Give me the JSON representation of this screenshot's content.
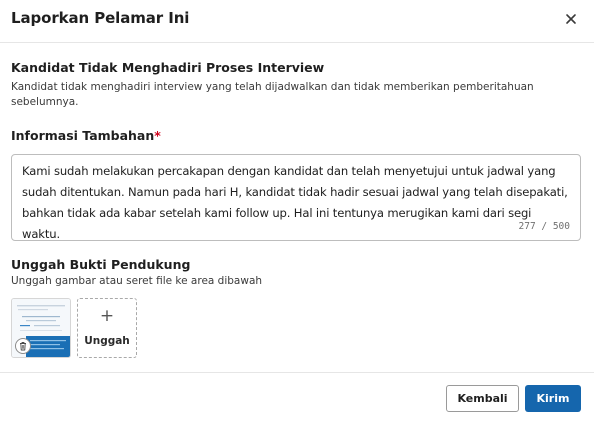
{
  "dialog": {
    "title": "Laporkan Pelamar Ini",
    "close_icon": "close-icon"
  },
  "reason": {
    "title": "Kandidat Tidak Menghadiri Proses Interview",
    "description": "Kandidat tidak menghadiri interview yang telah dijadwalkan dan tidak memberikan pemberitahuan sebelumnya."
  },
  "additional_info": {
    "label": "Informasi Tambahan",
    "required_mark": "*",
    "value": "Kami sudah melakukan percakapan dengan kandidat dan telah menyetujui untuk jadwal yang sudah ditentukan. Namun pada hari H, kandidat tidak hadir sesuai jadwal yang telah disepakati, bahkan tidak ada kabar setelah kami follow up. Hal ini tentunya merugikan kami dari segi waktu.",
    "counter": "277 / 500"
  },
  "evidence": {
    "label": "Unggah Bukti Pendukung",
    "description": "Unggah gambar atau seret file ke area dibawah",
    "upload_label": "Unggah",
    "upload_icon": "+",
    "delete_icon": "trash-icon",
    "thumbnail_accent": "#1a6fb5"
  },
  "footer": {
    "back_label": "Kembali",
    "send_label": "Kirim"
  },
  "colors": {
    "primary": "#1566ad",
    "required": "#d0021b"
  }
}
